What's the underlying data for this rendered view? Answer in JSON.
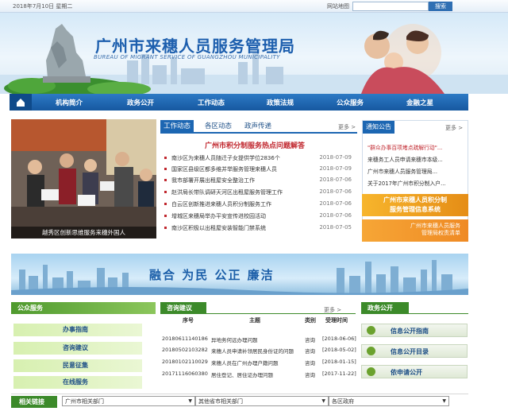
{
  "topbar": {
    "date": "2018年7月10日  星期二",
    "sitemap": "网站地图",
    "search_button": "搜索",
    "search_value": ""
  },
  "banner": {
    "title": "广州市来穗人员服务管理局",
    "subtitle_en": "BUREAU OF MIGRANT SERVICE OF GUANGZHOU MUNICIPALITY"
  },
  "nav": [
    "机构简介",
    "政务公开",
    "工作动态",
    "政策法规",
    "公众服务",
    "金融之星"
  ],
  "feature": {
    "caption": "越秀区创新思维服务来穗外国人"
  },
  "news_tabs": {
    "tabs": [
      "工作动态",
      "各区动态",
      "政声传递"
    ],
    "more": "更多 >"
  },
  "hot_title": "广州市积分制服务热点问题解答",
  "news": [
    {
      "title": "南沙区为来穗人员随迁子女提供学位2836个",
      "date": "2018-07-09"
    },
    {
      "title": "国家区县级区都多维并举服务管理来穗人员",
      "date": "2018-07-09"
    },
    {
      "title": "我市部署开展出租屋安全整治工作",
      "date": "2018-07-06"
    },
    {
      "title": "赵洪局长带队调研天河区出租屋服务管理工作",
      "date": "2018-07-06"
    },
    {
      "title": "白云区创新推进来穗人员积分制服务工作",
      "date": "2018-07-06"
    },
    {
      "title": "增城区来穗局举办平安宣传进校园活动",
      "date": "2018-07-06"
    },
    {
      "title": "南沙区积极以出租屋安装智能门禁系统",
      "date": "2018-07-05"
    }
  ],
  "notice": {
    "header": "通知公告",
    "more": "更多 >",
    "items": [
      "\"群众办事百项堵点疏解行动\"...",
      "来穗务工人员申请来穗市本级...",
      "广州市来穗人员服务管理局...",
      "关于2017年广州市积分制入户..."
    ],
    "promo1": "广州市来穗人员积分制\n服务管理信息系统",
    "promo2": "广州市来穗人员服务\n管理局权责清单"
  },
  "mid_banner": {
    "slogan": "融合  为民  公正  廉洁"
  },
  "public_service": {
    "header": "公众服务",
    "items": [
      "办事指南",
      "咨询建议",
      "民意征集",
      "在线服务"
    ]
  },
  "consult": {
    "header": "咨询建议",
    "more": "更多 >",
    "columns": [
      "序号",
      "主题",
      "类别",
      "受理时间"
    ],
    "rows": [
      [
        "20180611140186",
        "异地务何远办理问题",
        "咨询",
        "[2018-06-06]"
      ],
      [
        "20180502103282",
        "来穗人员申请补领居民身份证的问题",
        "咨询",
        "[2018-05-02]"
      ],
      [
        "20180102110029",
        "来穗人员在广州办理户籍问题",
        "咨询",
        "[2018-01-15]"
      ],
      [
        "20171116060380",
        "居住登记、居住证办理问题",
        "咨询",
        "[2017-11-22]"
      ]
    ]
  },
  "gov_open": {
    "header": "政务公开",
    "items": [
      "信息公开指南",
      "信息公开目录",
      "依申请公开"
    ]
  },
  "links": {
    "header": "相关链接",
    "selects": [
      "广州市相关部门",
      "其他省市相关部门",
      "各区政府"
    ]
  },
  "colors": {
    "nav_blue": "#1658a0",
    "title_blue": "#1d5fae",
    "green": "#3c8a2a",
    "red": "#c0262d"
  }
}
